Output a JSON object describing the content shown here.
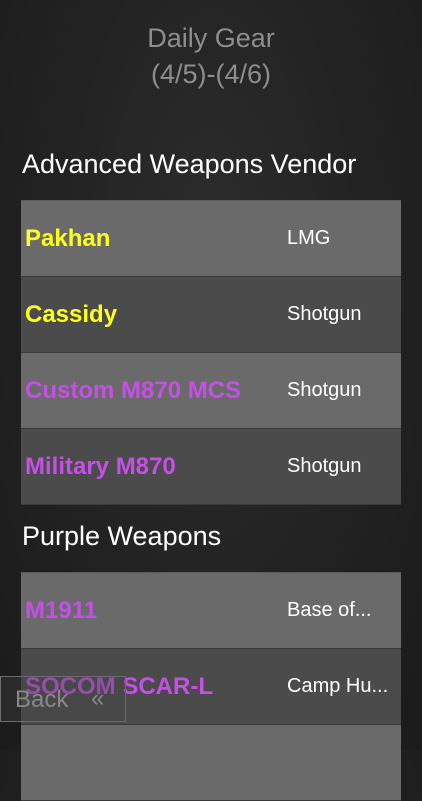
{
  "header": {
    "title": "Daily Gear",
    "date_range": "(4/5)-(4/6)"
  },
  "sections": [
    {
      "title": "Advanced Weapons Vendor",
      "items": [
        {
          "name": "Pakhan",
          "type": "LMG",
          "color": "#ffff1e"
        },
        {
          "name": "Cassidy",
          "type": "Shotgun",
          "color": "#ffff1e"
        },
        {
          "name": "Custom M870 MCS",
          "type": "Shotgun",
          "color": "#c64fe8"
        },
        {
          "name": "Military M870",
          "type": "Shotgun",
          "color": "#c64fe8"
        }
      ]
    },
    {
      "title": "Purple Weapons",
      "items": [
        {
          "name": "M1911",
          "type": "Base of...",
          "color": "#c64fe8"
        },
        {
          "name": "SOCOM SCAR-L",
          "type": "Camp Hu...",
          "color": "#c64fe8"
        },
        {
          "name": "",
          "type": "",
          "color": "#c64fe8"
        }
      ]
    }
  ],
  "nav": {
    "back_label": "Back",
    "back_icon": "double-chevron-left-icon",
    "back_glyph": "«"
  },
  "colors": {
    "exotic_yellow": "#ffff1e",
    "high_end_purple": "#c64fe8"
  }
}
